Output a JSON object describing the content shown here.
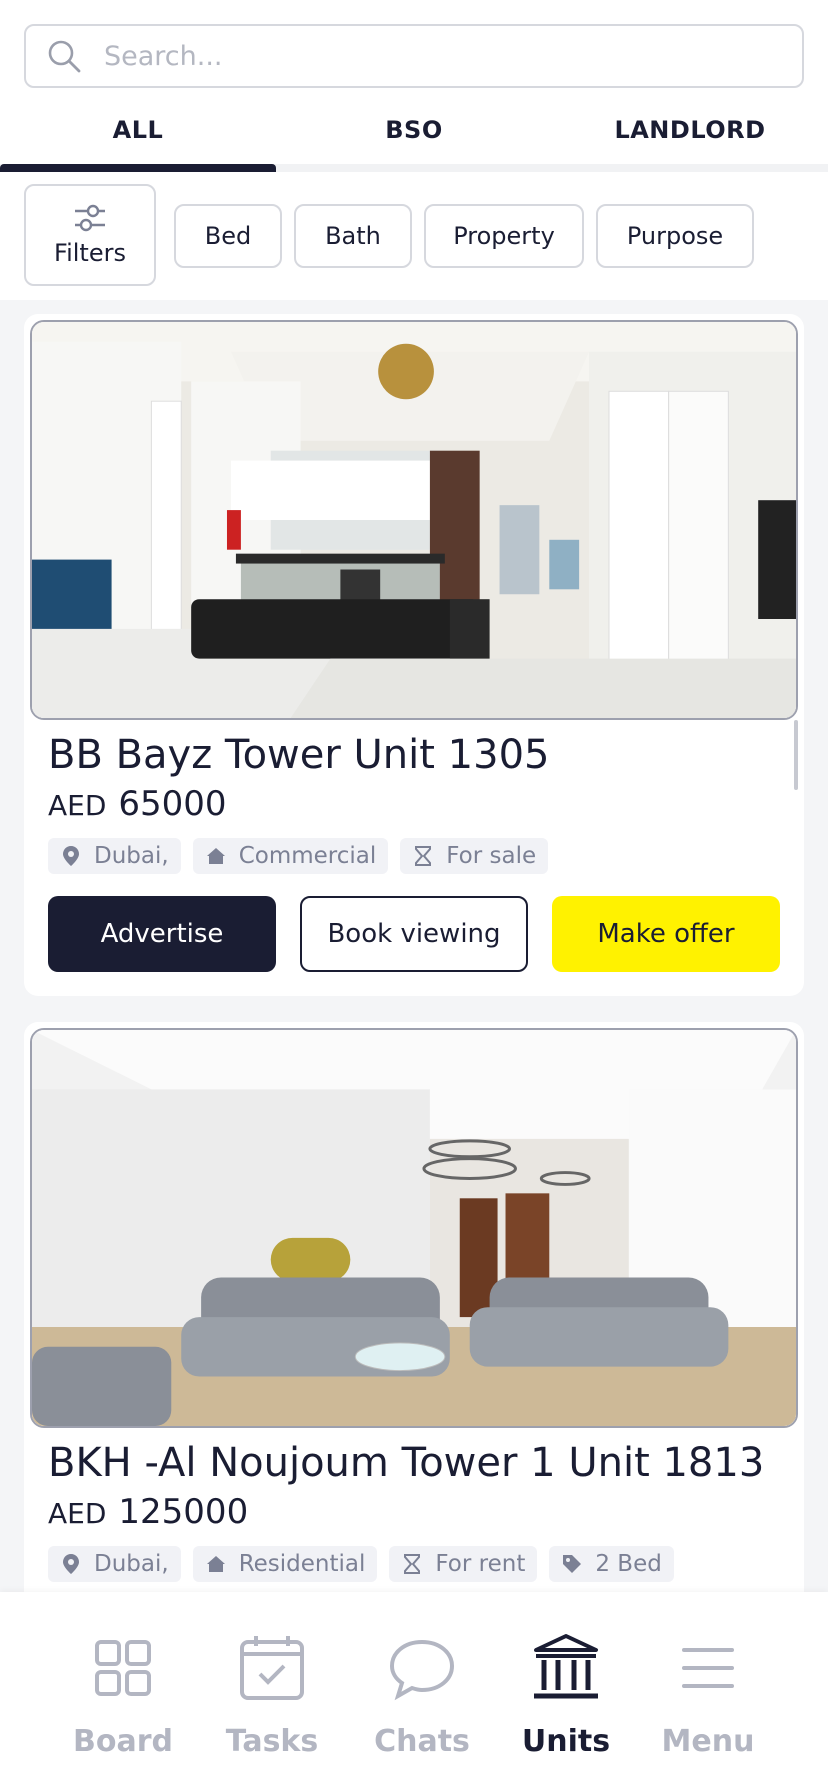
{
  "search": {
    "placeholder": "Search..."
  },
  "tabs": [
    {
      "label": "ALL",
      "active": true
    },
    {
      "label": "BSO",
      "active": false
    },
    {
      "label": "LANDLORD",
      "active": false
    }
  ],
  "filters": {
    "button_label": "Filters",
    "chips": [
      "Bed",
      "Bath",
      "Property",
      "Purpose"
    ]
  },
  "units": [
    {
      "title": "BB Bayz Tower Unit 1305",
      "currency": "AED",
      "price": "65000",
      "tags": [
        {
          "icon": "location-pin-icon",
          "text": "Dubai,"
        },
        {
          "icon": "home-icon",
          "text": "Commercial"
        },
        {
          "icon": "hourglass-icon",
          "text": "For sale"
        }
      ],
      "actions": {
        "advertise": "Advertise",
        "book": "Book viewing",
        "offer": "Make offer"
      }
    },
    {
      "title": "BKH -Al Noujoum Tower 1 Unit 1813",
      "currency": "AED",
      "price": "125000",
      "tags": [
        {
          "icon": "location-pin-icon",
          "text": "Dubai,"
        },
        {
          "icon": "home-icon",
          "text": "Residential"
        },
        {
          "icon": "hourglass-icon",
          "text": "For rent"
        },
        {
          "icon": "tag-icon",
          "text": "2 Bed"
        }
      ]
    }
  ],
  "bottom_nav": [
    {
      "label": "Board",
      "icon": "grid-icon",
      "active": false
    },
    {
      "label": "Tasks",
      "icon": "calendar-check-icon",
      "active": false
    },
    {
      "label": "Chats",
      "icon": "chat-bubble-icon",
      "active": false
    },
    {
      "label": "Units",
      "icon": "building-columns-icon",
      "active": true
    },
    {
      "label": "Menu",
      "icon": "hamburger-menu-icon",
      "active": false
    }
  ],
  "colors": {
    "primary": "#1a1d33",
    "accent": "#fff200",
    "muted": "#b3b6c2",
    "tag_bg": "#f1f2f6"
  }
}
